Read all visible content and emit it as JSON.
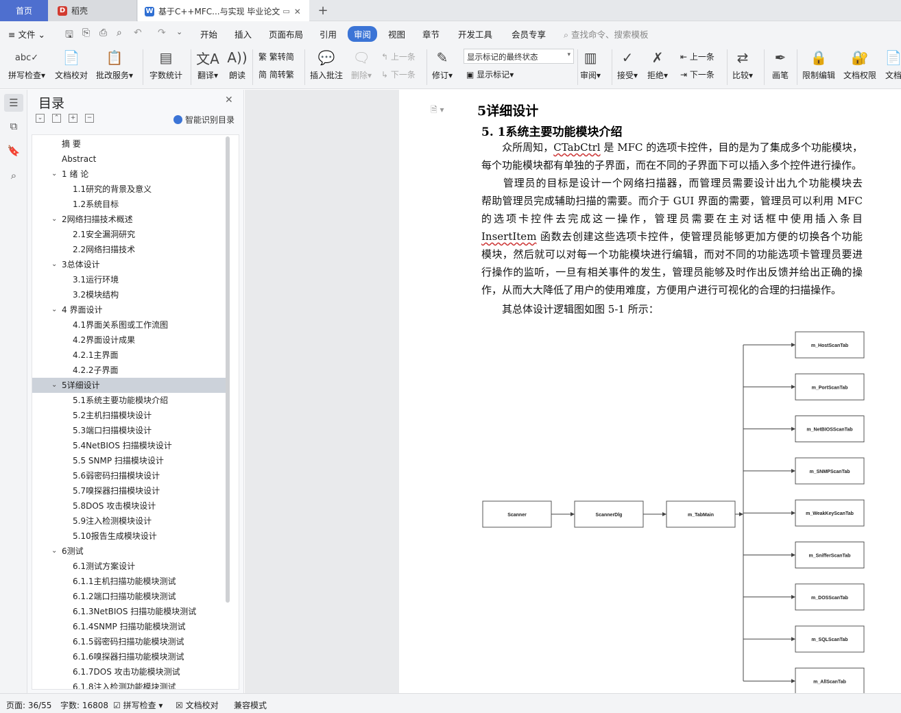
{
  "tabs": {
    "home": "首页",
    "daoke": "稻壳",
    "doc": "基于C++MFC...与实现 毕业论文"
  },
  "menu": {
    "file": "文件",
    "items": [
      "开始",
      "插入",
      "页面布局",
      "引用",
      "审阅",
      "视图",
      "章节",
      "开发工具",
      "会员专享"
    ],
    "search": "查找命令、搜索模板"
  },
  "ribbon": {
    "spell": "拼写检查",
    "doccheck": "文档校对",
    "batch": "批改服务",
    "wordcount": "字数统计",
    "translate": "翻译",
    "read": "朗读",
    "to_trad": "繁转简",
    "to_simp": "简转繁",
    "insert_comment": "插入批注",
    "delete": "删除",
    "prev_comment": "上一条",
    "next_comment": "下一条",
    "revise": "修订",
    "mark_state": "显示标记的最终状态",
    "show_marks": "显示标记",
    "review": "审阅",
    "accept": "接受",
    "reject": "拒绝",
    "prev": "上一条",
    "next": "下一条",
    "compare": "比较",
    "pen": "画笔",
    "restrict": "限制编辑",
    "perm": "文档权限",
    "more": "文档"
  },
  "toc": {
    "title": "目录",
    "smart": "智能识别目录",
    "items": [
      {
        "text": "摘  要",
        "level": 0,
        "chev": false
      },
      {
        "text": "Abstract",
        "level": 0,
        "chev": false
      },
      {
        "text": "1  绪 论",
        "level": 0,
        "chev": true
      },
      {
        "text": "1.1研究的背景及意义",
        "level": 1,
        "chev": false
      },
      {
        "text": "1.2系统目标",
        "level": 1,
        "chev": false
      },
      {
        "text": "2网络扫描技术概述",
        "level": 0,
        "chev": true
      },
      {
        "text": "2.1安全漏洞研究",
        "level": 1,
        "chev": false
      },
      {
        "text": "2.2网络扫描技术",
        "level": 1,
        "chev": false
      },
      {
        "text": "3总体设计",
        "level": 0,
        "chev": true
      },
      {
        "text": "3.1运行环境",
        "level": 1,
        "chev": false
      },
      {
        "text": "3.2模块结构",
        "level": 1,
        "chev": false
      },
      {
        "text": "4 界面设计",
        "level": 0,
        "chev": true
      },
      {
        "text": "4.1界面关系图或工作流图",
        "level": 1,
        "chev": false
      },
      {
        "text": "4.2界面设计成果",
        "level": 1,
        "chev": false
      },
      {
        "text": "4.2.1主界面",
        "level": 1,
        "chev": false
      },
      {
        "text": "4.2.2子界面",
        "level": 1,
        "chev": false
      },
      {
        "text": "5详细设计",
        "level": 0,
        "chev": true,
        "active": true
      },
      {
        "text": "5.1系统主要功能模块介绍",
        "level": 1,
        "chev": false
      },
      {
        "text": "5.2主机扫描模块设计",
        "level": 1,
        "chev": false
      },
      {
        "text": "5.3端口扫描模块设计",
        "level": 1,
        "chev": false
      },
      {
        "text": "5.4NetBIOS 扫描模块设计",
        "level": 1,
        "chev": false
      },
      {
        "text": "5.5 SNMP 扫描模块设计",
        "level": 1,
        "chev": false
      },
      {
        "text": "5.6弱密码扫描模块设计",
        "level": 1,
        "chev": false
      },
      {
        "text": "5.7嗅探器扫描模块设计",
        "level": 1,
        "chev": false
      },
      {
        "text": "5.8DOS 攻击模块设计",
        "level": 1,
        "chev": false
      },
      {
        "text": "5.9注入检测模块设计",
        "level": 1,
        "chev": false
      },
      {
        "text": "5.10报告生成模块设计",
        "level": 1,
        "chev": false
      },
      {
        "text": "6测试",
        "level": 0,
        "chev": true
      },
      {
        "text": "6.1测试方案设计",
        "level": 1,
        "chev": false
      },
      {
        "text": "6.1.1主机扫描功能模块测试",
        "level": 1,
        "chev": false
      },
      {
        "text": "6.1.2端口扫描功能模块测试",
        "level": 1,
        "chev": false
      },
      {
        "text": "6.1.3NetBIOS 扫描功能模块测试",
        "level": 1,
        "chev": false
      },
      {
        "text": "6.1.4SNMP 扫描功能模块测试",
        "level": 1,
        "chev": false
      },
      {
        "text": "6.1.5弱密码扫描功能模块测试",
        "level": 1,
        "chev": false
      },
      {
        "text": "6.1.6嗅探器扫描功能模块测试",
        "level": 1,
        "chev": false
      },
      {
        "text": "6.1.7DOS 攻击功能模块测试",
        "level": 1,
        "chev": false
      },
      {
        "text": "6.1.8注入检测功能模块测试",
        "level": 1,
        "chev": false
      }
    ]
  },
  "document": {
    "h1": "5详细设计",
    "h2": "5. 1系统主要功能模块介绍",
    "p1": [
      [
        "　　众所周知，",
        {
          "u": "CTabCtrl"
        },
        " 是 MFC 的选项卡控件，目的是为了集成多个功能模块，"
      ],
      [
        "每个功能模块都有单独的子界面，而在不同的子界面下可以插入多个控件进行操作。"
      ]
    ],
    "p2": [
      [
        "　　管理员的目标是设计一个网络扫描器，而管理员需要设计出九个功能模块去"
      ],
      [
        "帮助管理员完成辅助扫描的需要。而介于 GUI 界面的需要，管理员可以利用 MFC"
      ],
      [
        "的选项卡控件去完成这一操作，管理员需要在主对话框中使用插入条目"
      ],
      [
        {
          "u": "InsertItem"
        },
        " 函数去创建这些选项卡控件，使管理员能够更加方便的切换各个功能"
      ],
      [
        "模块，然后就可以对每一个功能模块进行编辑，而对不同的功能选项卡管理员要进"
      ],
      [
        "行操作的监听，一旦有相关事件的发生，管理员能够及时作出反馈并给出正确的操"
      ],
      [
        "作，从而大大降低了用户的使用难度，方便用户进行可视化的合理的扫描操作。"
      ]
    ],
    "p3": "　　其总体设计逻辑图如图  5-1 所示：",
    "diagram": {
      "chain": [
        "Scanner",
        "ScannerDlg",
        "m_TabMain"
      ],
      "tabs": [
        "m_HostScanTab",
        "m_PortScanTab",
        "m_NetBIOSScanTab",
        "m_SNMPScanTab",
        "m_WeakKeyScanTab",
        "m_SnifferScanTab",
        "m_DOSScanTab",
        "m_SQLScanTab",
        "m_AllScanTab"
      ]
    }
  },
  "status": {
    "page": "页面: 36/55",
    "words": "字数: 16808",
    "spell": "拼写检查",
    "doccheck": "文档校对",
    "compat": "兼容模式"
  }
}
